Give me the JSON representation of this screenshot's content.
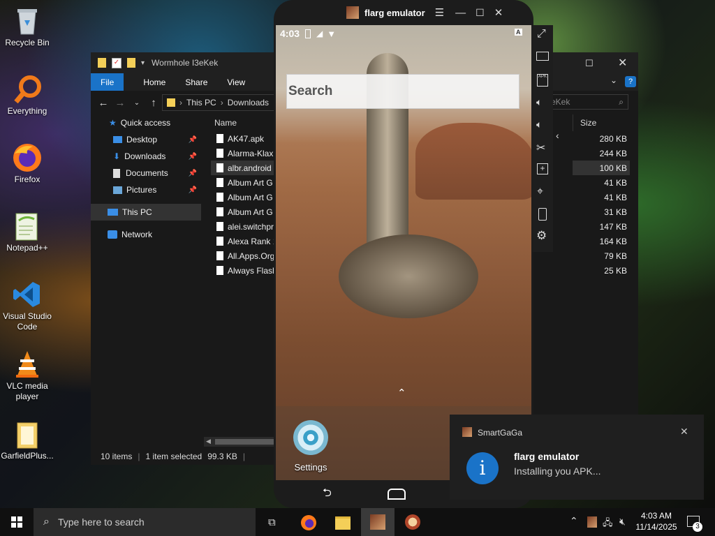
{
  "desktop": {
    "icons": [
      {
        "label": "Recycle Bin",
        "icon": "recycle-bin-icon"
      },
      {
        "label": "Everything",
        "icon": "search-icon"
      },
      {
        "label": "Firefox",
        "icon": "firefox-icon"
      },
      {
        "label": "Notepad++",
        "icon": "notepad-icon"
      },
      {
        "label": "Visual Studio Code",
        "icon": "vscode-icon"
      },
      {
        "label": "VLC media player",
        "icon": "vlc-icon"
      },
      {
        "label": "GarfieldPlus...",
        "icon": "folder-icon"
      }
    ]
  },
  "explorer": {
    "title": "Wormhole I3eKek",
    "ribbon": {
      "file": "File",
      "home": "Home",
      "share": "Share",
      "view": "View"
    },
    "address": {
      "this_pc": "This PC",
      "downloads": "Downloads"
    },
    "search_placeholder": "I3eKek",
    "nav": {
      "quick_access": "Quick access",
      "desktop": "Desktop",
      "downloads": "Downloads",
      "documents": "Documents",
      "pictures": "Pictures",
      "this_pc": "This PC",
      "network": "Network"
    },
    "columns": {
      "name": "Name",
      "size": "Size"
    },
    "files": [
      {
        "name": "AK47.apk",
        "size": "280 KB"
      },
      {
        "name": "Alarma-Klax",
        "size": "244 KB"
      },
      {
        "name": "albr.android",
        "size": "100 KB"
      },
      {
        "name": "Album Art G",
        "size": "41 KB"
      },
      {
        "name": "Album Art G",
        "size": "41 KB"
      },
      {
        "name": "Album Art G",
        "size": "31 KB"
      },
      {
        "name": "alei.switchpr",
        "size": "147 KB"
      },
      {
        "name": "Alexa Rank 1",
        "size": "164 KB"
      },
      {
        "name": "All.Apps.Org",
        "size": "79 KB"
      },
      {
        "name": "Always Flash",
        "size": "25 KB"
      }
    ],
    "status": {
      "items": "10 items",
      "selected": "1 item selected",
      "size": "99.3 KB"
    }
  },
  "emulator": {
    "title": "flarg emulator",
    "status_time": "4:03",
    "status_letter": "A",
    "search_label": "Search",
    "settings_label": "Settings"
  },
  "toast": {
    "app": "SmartGaGa",
    "title": "flarg emulator",
    "body": "Installing you APK..."
  },
  "taskbar": {
    "search_placeholder": "Type here to search",
    "time": "4:03 AM",
    "date": "11/14/2025",
    "notifications": "3"
  }
}
